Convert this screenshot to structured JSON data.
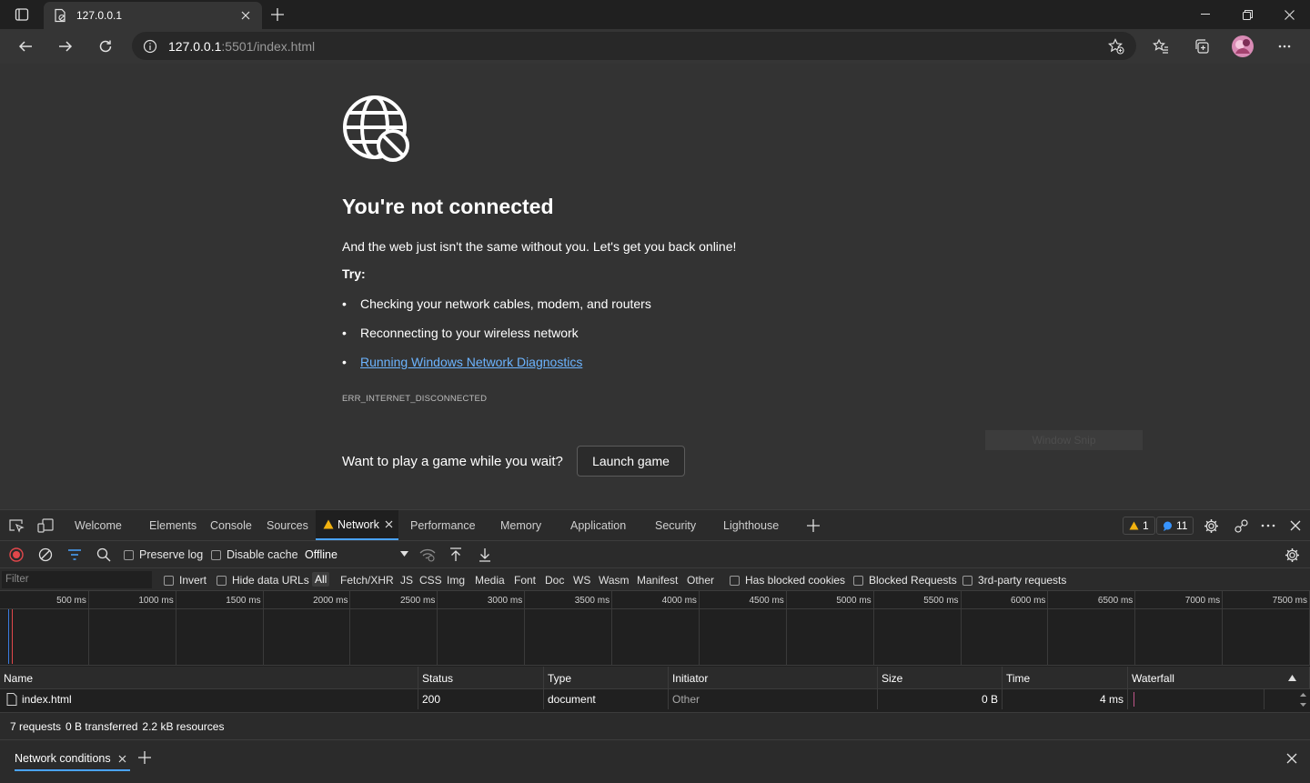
{
  "browser": {
    "tab_title": "127.0.0.1",
    "url_host": "127.0.0.1",
    "url_path": ":5501/index.html"
  },
  "error_page": {
    "title": "You're not connected",
    "description": "And the web just isn't the same without you. Let's get you back online!",
    "try_label": "Try:",
    "suggestions": [
      "Checking your network cables, modem, and routers",
      "Reconnecting to your wireless network",
      "Running Windows Network Diagnostics"
    ],
    "error_code": "ERR_INTERNET_DISCONNECTED",
    "game_prompt": "Want to play a game while you wait?",
    "launch_button": "Launch game",
    "snip_label": "Window Snip"
  },
  "devtools": {
    "tabs": [
      "Welcome",
      "Elements",
      "Console",
      "Sources",
      "Network",
      "Performance",
      "Memory",
      "Application",
      "Security",
      "Lighthouse"
    ],
    "warnings_count": "1",
    "messages_count": "11",
    "toolbar": {
      "preserve_log": "Preserve log",
      "disable_cache": "Disable cache",
      "throttling": "Offline"
    },
    "filter": {
      "placeholder": "Filter",
      "invert": "Invert",
      "hide_data_urls": "Hide data URLs",
      "types": [
        "All",
        "Fetch/XHR",
        "JS",
        "CSS",
        "Img",
        "Media",
        "Font",
        "Doc",
        "WS",
        "Wasm",
        "Manifest",
        "Other"
      ],
      "has_blocked_cookies": "Has blocked cookies",
      "blocked_requests": "Blocked Requests",
      "third_party": "3rd-party requests"
    },
    "timeline_ticks": [
      "500 ms",
      "1000 ms",
      "1500 ms",
      "2000 ms",
      "2500 ms",
      "3000 ms",
      "3500 ms",
      "4000 ms",
      "4500 ms",
      "5000 ms",
      "5500 ms",
      "6000 ms",
      "6500 ms",
      "7000 ms",
      "7500 ms"
    ],
    "columns": [
      "Name",
      "Status",
      "Type",
      "Initiator",
      "Size",
      "Time",
      "Waterfall"
    ],
    "rows": [
      {
        "name": "index.html",
        "status": "200",
        "type": "document",
        "initiator": "Other",
        "size": "0 B",
        "time": "4 ms"
      }
    ],
    "summary": {
      "requests": "7 requests",
      "transferred": "0 B transferred",
      "resources": "2.2 kB resources"
    },
    "drawer_tab": "Network conditions"
  }
}
